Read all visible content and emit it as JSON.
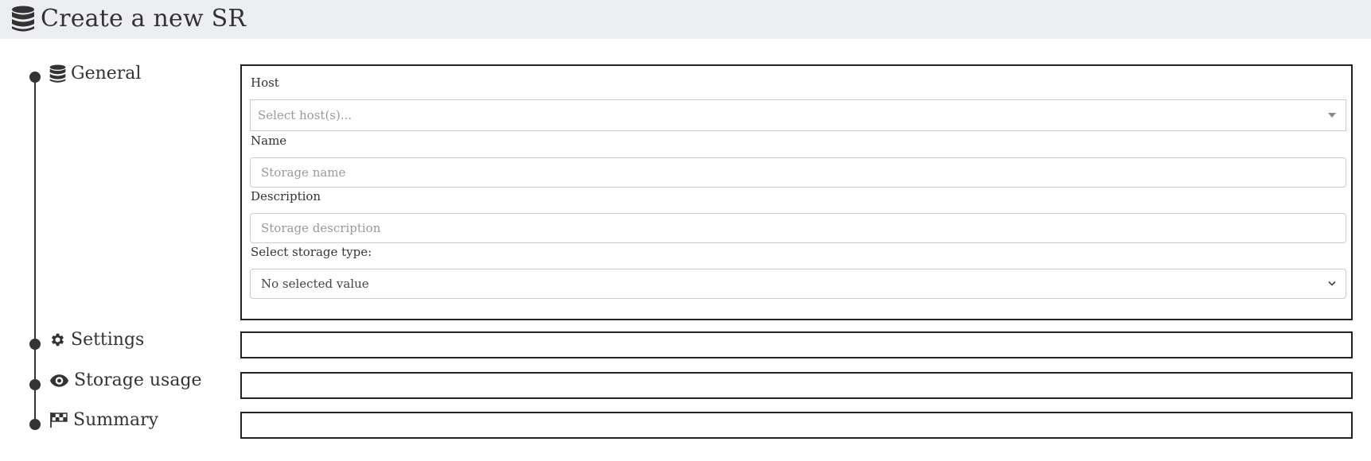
{
  "header": {
    "title": "Create a new SR",
    "icon": "database-icon"
  },
  "steps": [
    {
      "label": "General",
      "icon": "database-icon"
    },
    {
      "label": "Settings",
      "icon": "gear-icon"
    },
    {
      "label": "Storage usage",
      "icon": "eye-icon"
    },
    {
      "label": "Summary",
      "icon": "flag-checkered-icon"
    }
  ],
  "general": {
    "host": {
      "label": "Host",
      "placeholder": "Select host(s)..."
    },
    "name": {
      "label": "Name",
      "placeholder": "Storage name"
    },
    "description": {
      "label": "Description",
      "placeholder": "Storage description"
    },
    "storage_type": {
      "label": "Select storage type:",
      "value": "No selected value"
    }
  },
  "colors": {
    "header_bg": "#eceef1",
    "text": "#333333",
    "border": "#222222",
    "input_border": "#cccccc",
    "placeholder": "#999999"
  }
}
